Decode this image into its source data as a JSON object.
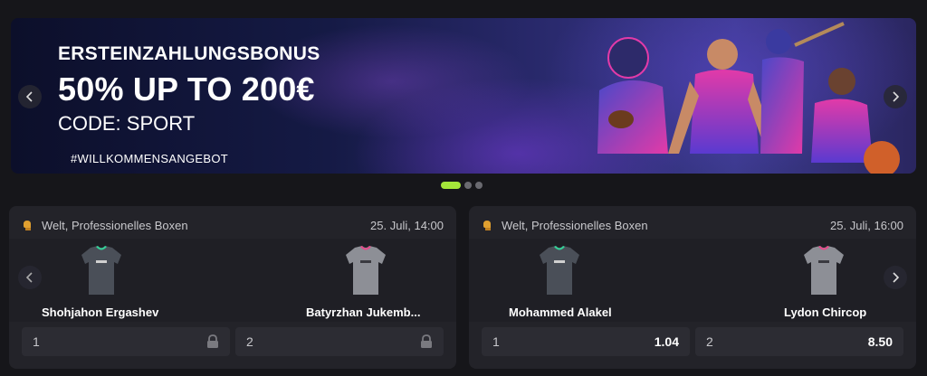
{
  "banner": {
    "title": "ERSTEINZAHLUNGSBONUS",
    "amount": "50% UP TO 200€",
    "code": "CODE: SPORT",
    "tag": "#WILLKOMMENSANGEBOT",
    "prev_icon": "chevron-left-icon",
    "next_icon": "chevron-right-icon"
  },
  "carousel": {
    "slides": 3,
    "active": 0
  },
  "matches": [
    {
      "league": "Welt, Professionelles Boxen",
      "time": "25. Juli, 14:00",
      "home": "Shohjahon Ergashev",
      "away": "Batyrzhan Jukemb...",
      "odds": [
        {
          "num": "1",
          "value": "",
          "locked": true
        },
        {
          "num": "2",
          "value": "",
          "locked": true
        }
      ]
    },
    {
      "league": "Welt, Professionelles Boxen",
      "time": "25. Juli, 16:00",
      "home": "Mohammed Alakel",
      "away": "Lydon Chircop",
      "odds": [
        {
          "num": "1",
          "value": "1.04",
          "locked": false
        },
        {
          "num": "2",
          "value": "8.50",
          "locked": false
        }
      ]
    }
  ],
  "colors": {
    "accent": "#a4e53a",
    "card_bg": "#232329",
    "page_bg": "#16161a"
  }
}
